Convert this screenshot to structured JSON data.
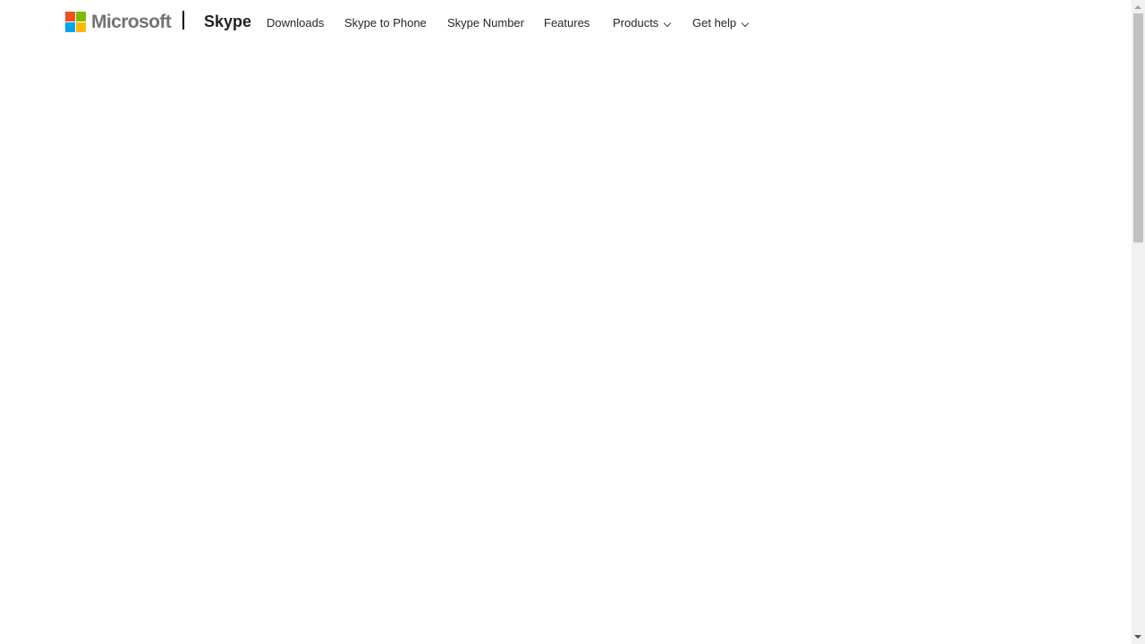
{
  "header": {
    "logo_text": "Microsoft",
    "logo_colors": [
      "#f25022",
      "#7fba00",
      "#00a4ef",
      "#ffb900"
    ],
    "brand": "Skype",
    "nav": [
      {
        "label": "Downloads",
        "has_dropdown": false
      },
      {
        "label": "Skype to Phone",
        "has_dropdown": false
      },
      {
        "label": "Skype Number",
        "has_dropdown": false
      },
      {
        "label": "Features",
        "has_dropdown": false
      },
      {
        "label": "Products",
        "has_dropdown": true,
        "icon": "chevron-down-icon"
      },
      {
        "label": "Get help",
        "has_dropdown": true,
        "icon": "chevron-down-icon"
      }
    ]
  },
  "scrollbar": {
    "position": 0
  }
}
